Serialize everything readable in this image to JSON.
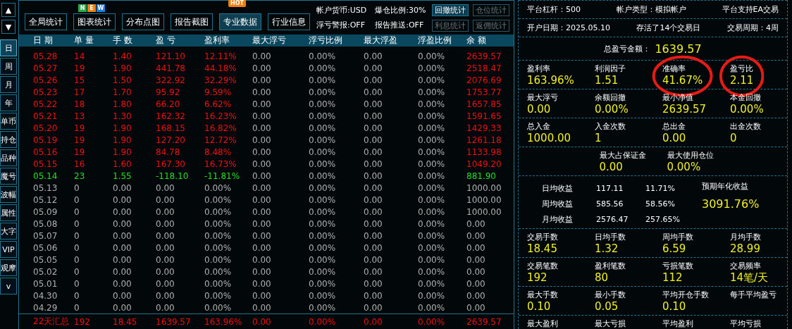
{
  "nav": {
    "up": "▲",
    "down": "▼"
  },
  "side_tabs": [
    {
      "label": "日",
      "selected": true
    },
    {
      "label": "周",
      "selected": false
    },
    {
      "label": "月",
      "selected": false
    },
    {
      "label": "年",
      "selected": false
    },
    {
      "label": "单币",
      "selected": false
    },
    {
      "label": "持仓",
      "selected": false
    },
    {
      "label": "品种",
      "selected": false
    },
    {
      "label": "魔号",
      "selected": false
    },
    {
      "label": "波幅",
      "selected": false
    },
    {
      "label": "属性",
      "selected": false
    },
    {
      "label": "大字",
      "selected": false
    },
    {
      "label": "VIP",
      "selected": false
    },
    {
      "label": "观摩",
      "selected": false
    },
    {
      "label": "v",
      "selected": false
    }
  ],
  "toolbar": {
    "buttons": [
      {
        "label": "全局统计",
        "selected": false
      },
      {
        "label": "图表统计",
        "selected": false,
        "badge_letters": [
          {
            "text": "N",
            "color": "#2ea84a"
          },
          {
            "text": "E",
            "color": "#f08010"
          },
          {
            "text": "W",
            "color": "#1e7fe0"
          }
        ]
      },
      {
        "label": "分布点图",
        "selected": false
      },
      {
        "label": "报告截图",
        "selected": false
      },
      {
        "label": "专业数据",
        "selected": true,
        "badge": "HOT"
      },
      {
        "label": "行业信息",
        "selected": false
      }
    ],
    "info": [
      "帐户货币:USD",
      "爆仓比例:30%",
      "浮亏警报:OFF",
      "报告推送:OFF"
    ],
    "small_buttons": [
      {
        "label": "回撤统计",
        "disabled": false
      },
      {
        "label": "仓位统计",
        "disabled": true
      },
      {
        "label": "利息统计",
        "disabled": true
      },
      {
        "label": "返佣统计",
        "disabled": true
      }
    ]
  },
  "table": {
    "columns": [
      "日 期",
      "单 量",
      "手 数",
      "盈 亏",
      "盈利率",
      "最大浮亏",
      "浮亏比例",
      "最大浮盈",
      "浮盈比例",
      "余 额"
    ],
    "rows": [
      {
        "kind": "profit",
        "cells": [
          "05.28",
          "14",
          "1.40",
          "121.10",
          "12.11%",
          "0.00",
          "0.00%",
          "0.00",
          "0.00%",
          "2639.57"
        ]
      },
      {
        "kind": "profit",
        "cells": [
          "05.27",
          "19",
          "1.90",
          "441.78",
          "44.18%",
          "0.00",
          "0.00%",
          "0.00",
          "0.00%",
          "2518.47"
        ]
      },
      {
        "kind": "profit",
        "cells": [
          "05.26",
          "15",
          "1.50",
          "322.92",
          "32.29%",
          "0.00",
          "0.00%",
          "0.00",
          "0.00%",
          "2076.69"
        ]
      },
      {
        "kind": "profit",
        "cells": [
          "05.23",
          "17",
          "1.70",
          "95.92",
          "9.59%",
          "0.00",
          "0.00%",
          "0.00",
          "0.00%",
          "1753.77"
        ]
      },
      {
        "kind": "profit",
        "cells": [
          "05.22",
          "18",
          "1.80",
          "66.20",
          "6.62%",
          "0.00",
          "0.00%",
          "0.00",
          "0.00%",
          "1657.85"
        ]
      },
      {
        "kind": "profit",
        "cells": [
          "05.21",
          "13",
          "1.30",
          "162.32",
          "16.23%",
          "0.00",
          "0.00%",
          "0.00",
          "0.00%",
          "1591.65"
        ]
      },
      {
        "kind": "profit",
        "cells": [
          "05.20",
          "19",
          "1.90",
          "168.15",
          "16.82%",
          "0.00",
          "0.00%",
          "0.00",
          "0.00%",
          "1429.33"
        ]
      },
      {
        "kind": "profit",
        "cells": [
          "05.19",
          "19",
          "1.90",
          "127.20",
          "12.72%",
          "0.00",
          "0.00%",
          "0.00",
          "0.00%",
          "1261.18"
        ]
      },
      {
        "kind": "profit",
        "cells": [
          "05.16",
          "19",
          "1.90",
          "84.78",
          "8.48%",
          "0.00",
          "0.00%",
          "0.00",
          "0.00%",
          "1133.98"
        ]
      },
      {
        "kind": "profit",
        "cells": [
          "05.15",
          "16",
          "1.60",
          "167.30",
          "16.73%",
          "0.00",
          "0.00%",
          "0.00",
          "0.00%",
          "1049.20"
        ]
      },
      {
        "kind": "loss",
        "cells": [
          "05.14",
          "23",
          "1.55",
          "-118.10",
          "-11.81%",
          "0.00",
          "0.00%",
          "0.00",
          "0.00%",
          "881.90"
        ]
      },
      {
        "kind": "flat",
        "cells": [
          "05.13",
          "0",
          "0.00",
          "0.00",
          "0.00%",
          "0.00",
          "0.00%",
          "0.00",
          "0.00%",
          "1000.00"
        ]
      },
      {
        "kind": "flat",
        "cells": [
          "05.12",
          "0",
          "0.00",
          "0.00",
          "0.00%",
          "0.00",
          "0.00%",
          "0.00",
          "0.00%",
          "1000.00"
        ]
      },
      {
        "kind": "flat",
        "cells": [
          "05.09",
          "0",
          "0.00",
          "0.00",
          "0.00%",
          "0.00",
          "0.00%",
          "0.00",
          "0.00%",
          "1000.00"
        ]
      },
      {
        "kind": "flat",
        "cells": [
          "05.08",
          "0",
          "0.00",
          "0.00",
          "0.00%",
          "0.00",
          "0.00%",
          "0.00",
          "0.00%",
          "0.00"
        ]
      },
      {
        "kind": "flat",
        "cells": [
          "05.07",
          "0",
          "0.00",
          "0.00",
          "0.00%",
          "0.00",
          "0.00%",
          "0.00",
          "0.00%",
          "0.00"
        ]
      },
      {
        "kind": "flat",
        "cells": [
          "05.06",
          "0",
          "0.00",
          "0.00",
          "0.00%",
          "0.00",
          "0.00%",
          "0.00",
          "0.00%",
          "0.00"
        ]
      },
      {
        "kind": "flat",
        "cells": [
          "05.05",
          "0",
          "0.00",
          "0.00",
          "0.00%",
          "0.00",
          "0.00%",
          "0.00",
          "0.00%",
          "0.00"
        ]
      },
      {
        "kind": "flat",
        "cells": [
          "05.02",
          "0",
          "0.00",
          "0.00",
          "0.00%",
          "0.00",
          "0.00%",
          "0.00",
          "0.00%",
          "0.00"
        ]
      },
      {
        "kind": "flat",
        "cells": [
          "05.01",
          "0",
          "0.00",
          "0.00",
          "0.00%",
          "0.00",
          "0.00%",
          "0.00",
          "0.00%",
          "0.00"
        ]
      },
      {
        "kind": "flat",
        "cells": [
          "04.30",
          "0",
          "0.00",
          "0.00",
          "0.00%",
          "0.00",
          "0.00%",
          "0.00",
          "0.00%",
          "0.00"
        ]
      },
      {
        "kind": "flat",
        "cells": [
          "04.29",
          "0",
          "0.00",
          "0.00",
          "0.00%",
          "0.00",
          "0.00%",
          "0.00",
          "0.00%",
          "0.00"
        ]
      }
    ],
    "total": {
      "kind": "profit",
      "cells": [
        "22天汇总",
        "192",
        "18.45",
        "1639.57",
        "163.96%",
        "0.00",
        "0.00%",
        "0.00",
        "0.00%",
        "2639.57"
      ]
    }
  },
  "summary": {
    "info_rows": [
      [
        "平台杠杆：500",
        "帐户类型：模拟帐户",
        "平台支持EA交易"
      ],
      [
        "开户日期：2025.05.10",
        "存活了14个交易日",
        "交易周期：4周"
      ]
    ],
    "total": {
      "label": "总盈亏金额：",
      "value": "1639.57"
    },
    "groups": [
      {
        "kind": "grid",
        "items": [
          {
            "label": "盈利率",
            "value": "163.96%",
            "circled": false
          },
          {
            "label": "利润因子",
            "value": "1.51",
            "circled": false
          },
          {
            "label": "准确率",
            "value": "41.67%",
            "circled": true
          },
          {
            "label": "盈亏比",
            "value": "2.11",
            "circled": true
          }
        ]
      },
      {
        "kind": "grid",
        "items": [
          {
            "label": "最大浮亏",
            "value": "0.00",
            "circled": false
          },
          {
            "label": "余额回撤",
            "value": "0.00%",
            "circled": false
          },
          {
            "label": "最小净值",
            "value": "2639.57",
            "circled": false
          },
          {
            "label": "本金回撤",
            "value": "0.00%",
            "circled": false
          }
        ]
      },
      {
        "kind": "grid",
        "items": [
          {
            "label": "总入金",
            "value": "1000.00",
            "circled": false
          },
          {
            "label": "入金次数",
            "value": "1",
            "circled": false
          },
          {
            "label": "总出金",
            "value": "0.00",
            "circled": false
          },
          {
            "label": "出金次数",
            "value": "0",
            "circled": false
          }
        ]
      },
      {
        "kind": "centered",
        "items": [
          {
            "label": "最大占保证金",
            "value": "0.00",
            "circled": false
          },
          {
            "label": "最大使用仓位",
            "value": "0.00%",
            "circled": false
          }
        ]
      },
      {
        "kind": "earnings",
        "rows": [
          {
            "label": "日均收益",
            "amount": "117.11",
            "percent": "11.71%"
          },
          {
            "label": "周均收益",
            "amount": "585.56",
            "percent": "58.56%"
          },
          {
            "label": "月均收益",
            "amount": "2576.47",
            "percent": "257.65%"
          }
        ],
        "annual": {
          "label": "预期年化收益",
          "value": "3091.76%"
        }
      },
      {
        "kind": "grid",
        "items": [
          {
            "label": "交易手数",
            "value": "18.45",
            "circled": false
          },
          {
            "label": "日均手数",
            "value": "1.32",
            "circled": false
          },
          {
            "label": "周均手数",
            "value": "6.59",
            "circled": false
          },
          {
            "label": "月均手数",
            "value": "28.99",
            "circled": false
          }
        ]
      },
      {
        "kind": "grid",
        "items": [
          {
            "label": "交易笔数",
            "value": "192",
            "circled": false
          },
          {
            "label": "盈利笔数",
            "value": "80",
            "circled": false
          },
          {
            "label": "亏损笔数",
            "value": "112",
            "circled": false
          },
          {
            "label": "交易频率",
            "value": "14笔/天",
            "circled": false
          }
        ]
      },
      {
        "kind": "grid",
        "items": [
          {
            "label": "最大手数",
            "value": "0.10",
            "circled": false
          },
          {
            "label": "最小手数",
            "value": "0.05",
            "circled": false
          },
          {
            "label": "平均开仓手数",
            "value": "0.10",
            "circled": false
          },
          {
            "label": "每手平均盈亏",
            "circled": false
          }
        ]
      },
      {
        "kind": "grid",
        "items": [
          {
            "label": "最大盈利",
            "circled": false
          },
          {
            "label": "最大亏损",
            "circled": false
          },
          {
            "label": "平均盈利",
            "circled": false
          },
          {
            "label": "平均亏损",
            "circled": false
          }
        ]
      }
    ]
  }
}
